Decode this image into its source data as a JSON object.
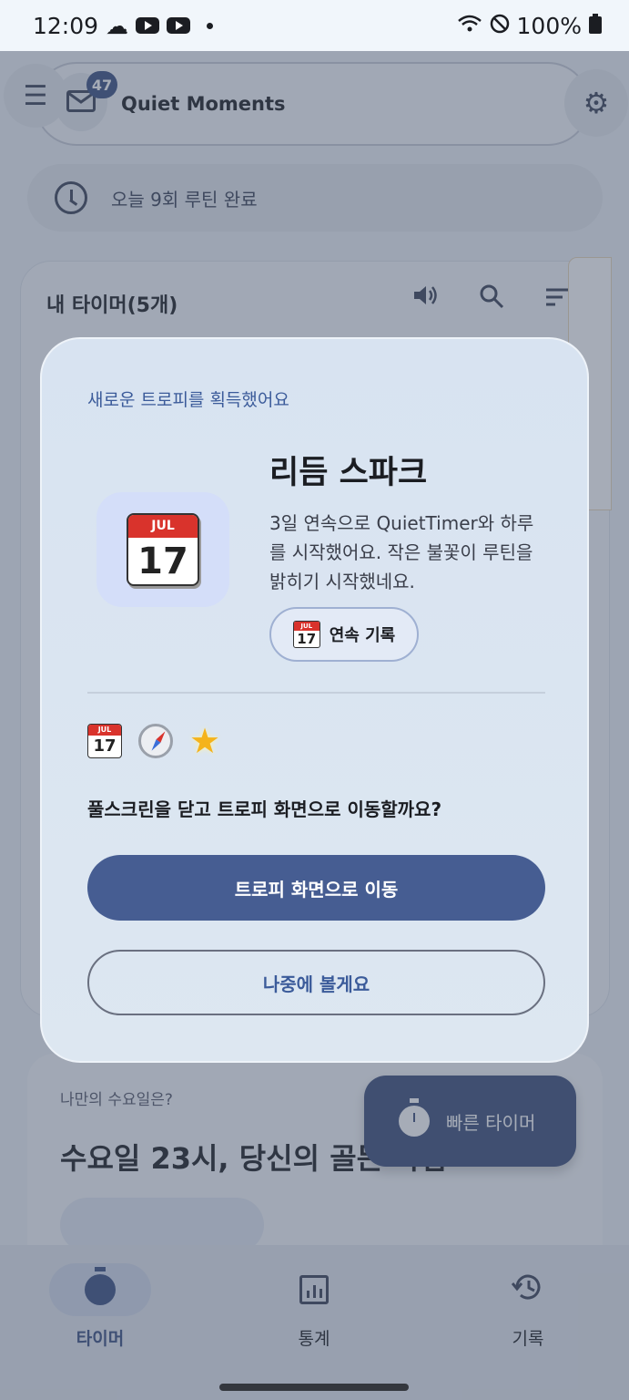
{
  "status_bar": {
    "time": "12:09",
    "battery": "100%"
  },
  "header": {
    "title": "Quiet Moments",
    "mail_count": "47"
  },
  "routine": {
    "text": "오늘 9회 루틴 완료"
  },
  "timers": {
    "title": "내 타이머(5개)"
  },
  "day_card": {
    "question": "나만의 수요일은?",
    "headline": "수요일 23시, 당신의 골든 타임"
  },
  "quick_timer": {
    "label": "빠른 타이머"
  },
  "nav": [
    {
      "label": "타이머"
    },
    {
      "label": "통계"
    },
    {
      "label": "기록"
    }
  ],
  "dialog": {
    "subtitle": "새로운 트로피를 획득했어요",
    "title": "리듬 스파크",
    "description": "3일 연속으로 QuietTimer와 하루를 시작했어요. 작은 불꽃이 루틴을 밝히기 시작했네요.",
    "chip_label": "연속 기록",
    "calendar_month": "JUL",
    "calendar_day": "17",
    "question": "풀스크린을 닫고 트로피 화면으로 이동할까요?",
    "primary_button": "트로피 화면으로 이동",
    "secondary_button": "나중에 볼게요"
  },
  "colors": {
    "accent": "#465d92",
    "scrim": "#465268",
    "dialog_bg": "#d8e3f1",
    "calendar_red": "#d9332c"
  }
}
